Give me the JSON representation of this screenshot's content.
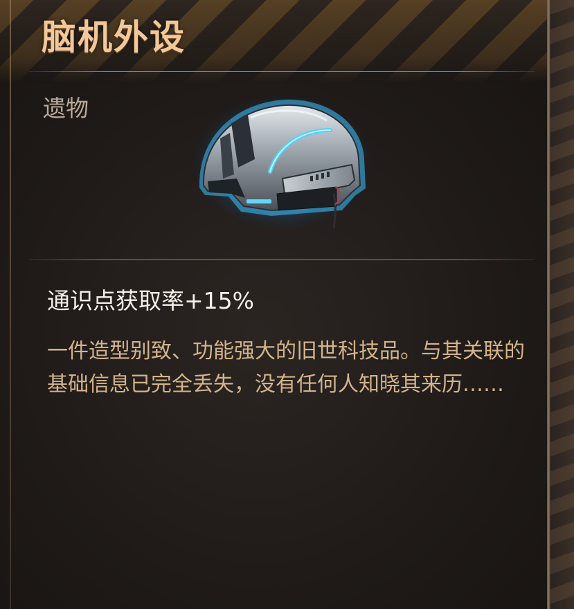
{
  "item": {
    "name": "脑机外设",
    "category": "遗物",
    "effect": "通识点获取率+15%",
    "description": "一件造型别致、功能强大的旧世科技品。与其关联的基础信息已完全丢失，没有任何人知晓其来历……",
    "icon": "helmet-icon"
  },
  "colors": {
    "title": "#f2c89a",
    "category": "#b9a99a",
    "effect": "#f5f1ea",
    "description": "#d3b48c",
    "divider": "#cd8750",
    "glow": "#2fb4ff",
    "background": "#1f1a18"
  }
}
